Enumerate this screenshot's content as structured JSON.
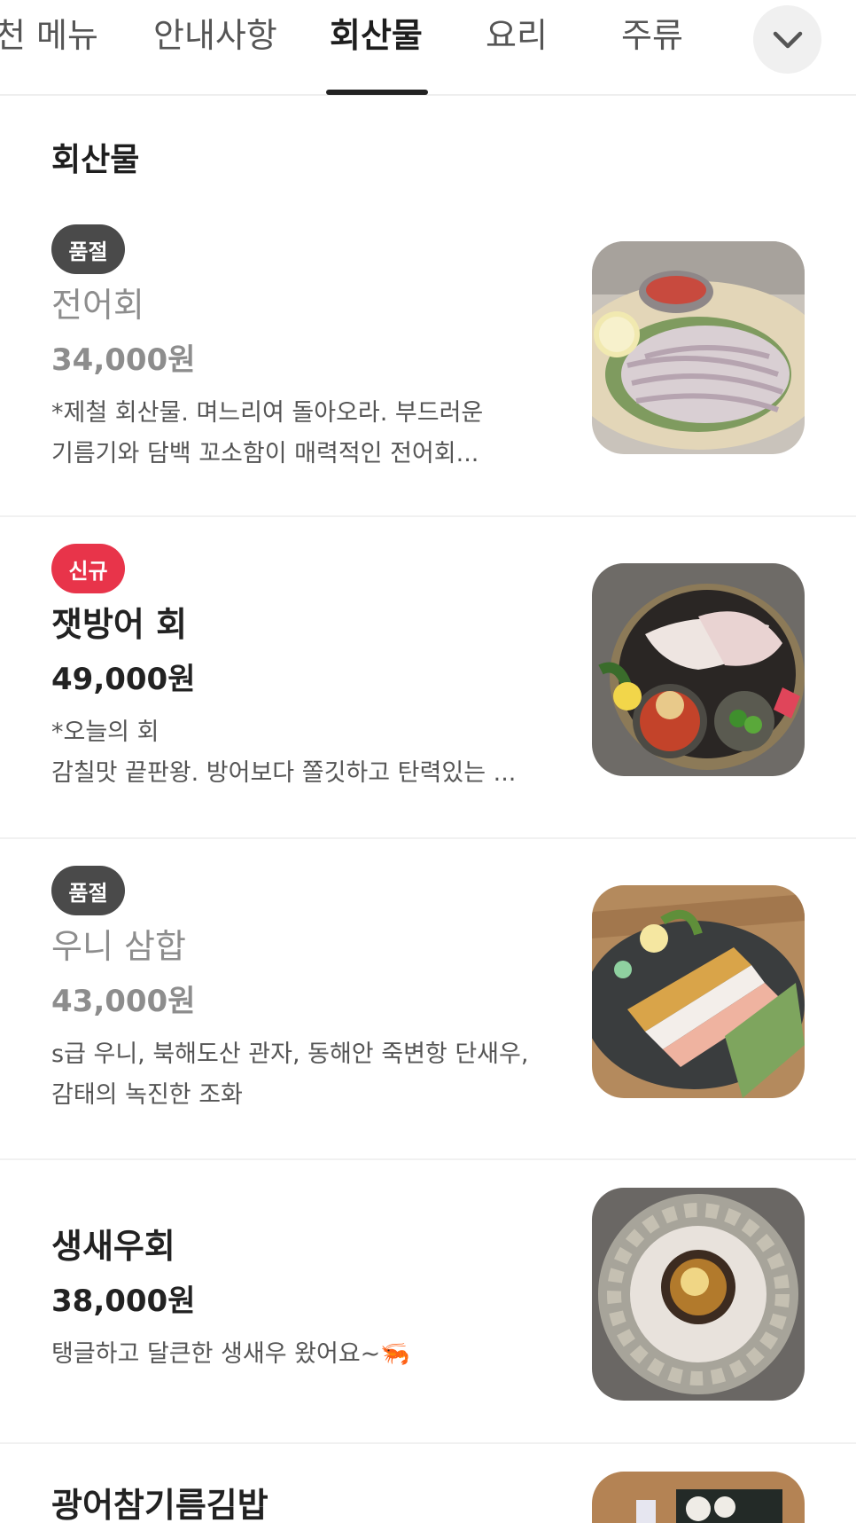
{
  "tabs": [
    {
      "label": "천 메뉴"
    },
    {
      "label": "안내사항"
    },
    {
      "label": "회산물"
    },
    {
      "label": "요리"
    },
    {
      "label": "주류"
    }
  ],
  "active_tab": "회산물",
  "section": {
    "title": "회산물"
  },
  "items": [
    {
      "badge": "품절",
      "name": "전어회",
      "price": "34,000원",
      "desc_line1": "*제철 회산물. 며느리여 돌아오라.  부드러운",
      "desc_line2": "기름기와 담백 꼬소함이 매력적인 전어회..."
    },
    {
      "badge": "신규",
      "name": "잿방어 회",
      "price": "49,000원",
      "desc_line1": "*오늘의 회",
      "desc_line2": "감칠맛 끝판왕. 방어보다 쫄깃하고 탄력있는 ..."
    },
    {
      "badge": "품절",
      "name": "우니 삼합",
      "price": "43,000원",
      "desc_line1": "s급 우니, 북해도산 관자, 동해안 죽변항 단새우,",
      "desc_line2": "감태의 녹진한 조화"
    },
    {
      "name": "생새우회",
      "price": "38,000원",
      "desc_line1": "탱글하고 달큰한 생새우 왔어요~🦐"
    },
    {
      "name": "광어참기름김밥"
    }
  ],
  "icons": {
    "more": "chevron-down-icon"
  },
  "colors": {
    "soldout_badge": "#4a4a4a",
    "new_badge": "#e8344a",
    "tab_underline": "#222222"
  }
}
